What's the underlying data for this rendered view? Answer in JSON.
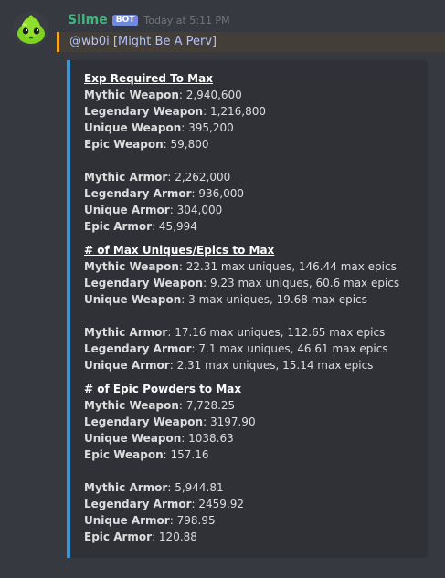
{
  "author": {
    "name": "Slime",
    "tag": "BOT",
    "timestamp": "Today at 5:11 PM",
    "avatar_icon": "slime-avatar-icon"
  },
  "mention": {
    "text": "@wb0i [Might Be A Perv]"
  },
  "colors": {
    "background": "#36393f",
    "embed_background": "#2f3136",
    "embed_accent": "#3498db",
    "username": "#43b581",
    "bot_tag": "#7289da",
    "mention_highlight": "#faa61a",
    "mention_text": "#b3c2f7"
  },
  "embed": {
    "sections": [
      {
        "title": "Exp Required To Max",
        "groups": [
          [
            {
              "key": "Mythic Weapon",
              "value": "2,940,600"
            },
            {
              "key": "Legendary Weapon",
              "value": "1,216,800"
            },
            {
              "key": "Unique Weapon",
              "value": "395,200"
            },
            {
              "key": "Epic Weapon",
              "value": "59,800"
            }
          ],
          [
            {
              "key": "Mythic Armor",
              "value": "2,262,000"
            },
            {
              "key": "Legendary Armor",
              "value": "936,000"
            },
            {
              "key": "Unique Armor",
              "value": "304,000"
            },
            {
              "key": "Epic Armor",
              "value": "45,994"
            }
          ]
        ]
      },
      {
        "title": "# of Max Uniques/Epics to Max",
        "groups": [
          [
            {
              "key": "Mythic Weapon",
              "value": "22.31 max uniques, 146.44 max epics"
            },
            {
              "key": "Legendary Weapon",
              "value": "9.23 max uniques, 60.6 max epics"
            },
            {
              "key": "Unique Weapon",
              "value": "3 max uniques, 19.68 max epics"
            }
          ],
          [
            {
              "key": "Mythic Armor",
              "value": "17.16 max uniques, 112.65 max epics"
            },
            {
              "key": "Legendary Armor",
              "value": "7.1 max uniques, 46.61 max epics"
            },
            {
              "key": "Unique Armor",
              "value": "2.31 max uniques, 15.14 max epics"
            }
          ]
        ]
      },
      {
        "title": "# of Epic Powders to Max",
        "groups": [
          [
            {
              "key": "Mythic Weapon",
              "value": "7,728.25"
            },
            {
              "key": "Legendary Weapon",
              "value": "3197.90"
            },
            {
              "key": "Unique Weapon",
              "value": "1038.63"
            },
            {
              "key": "Epic Weapon",
              "value": "157.16"
            }
          ],
          [
            {
              "key": "Mythic Armor",
              "value": "5,944.81"
            },
            {
              "key": "Legendary Armor",
              "value": "2459.92"
            },
            {
              "key": "Unique Armor",
              "value": "798.95"
            },
            {
              "key": "Epic Armor",
              "value": "120.88"
            }
          ]
        ]
      }
    ]
  }
}
